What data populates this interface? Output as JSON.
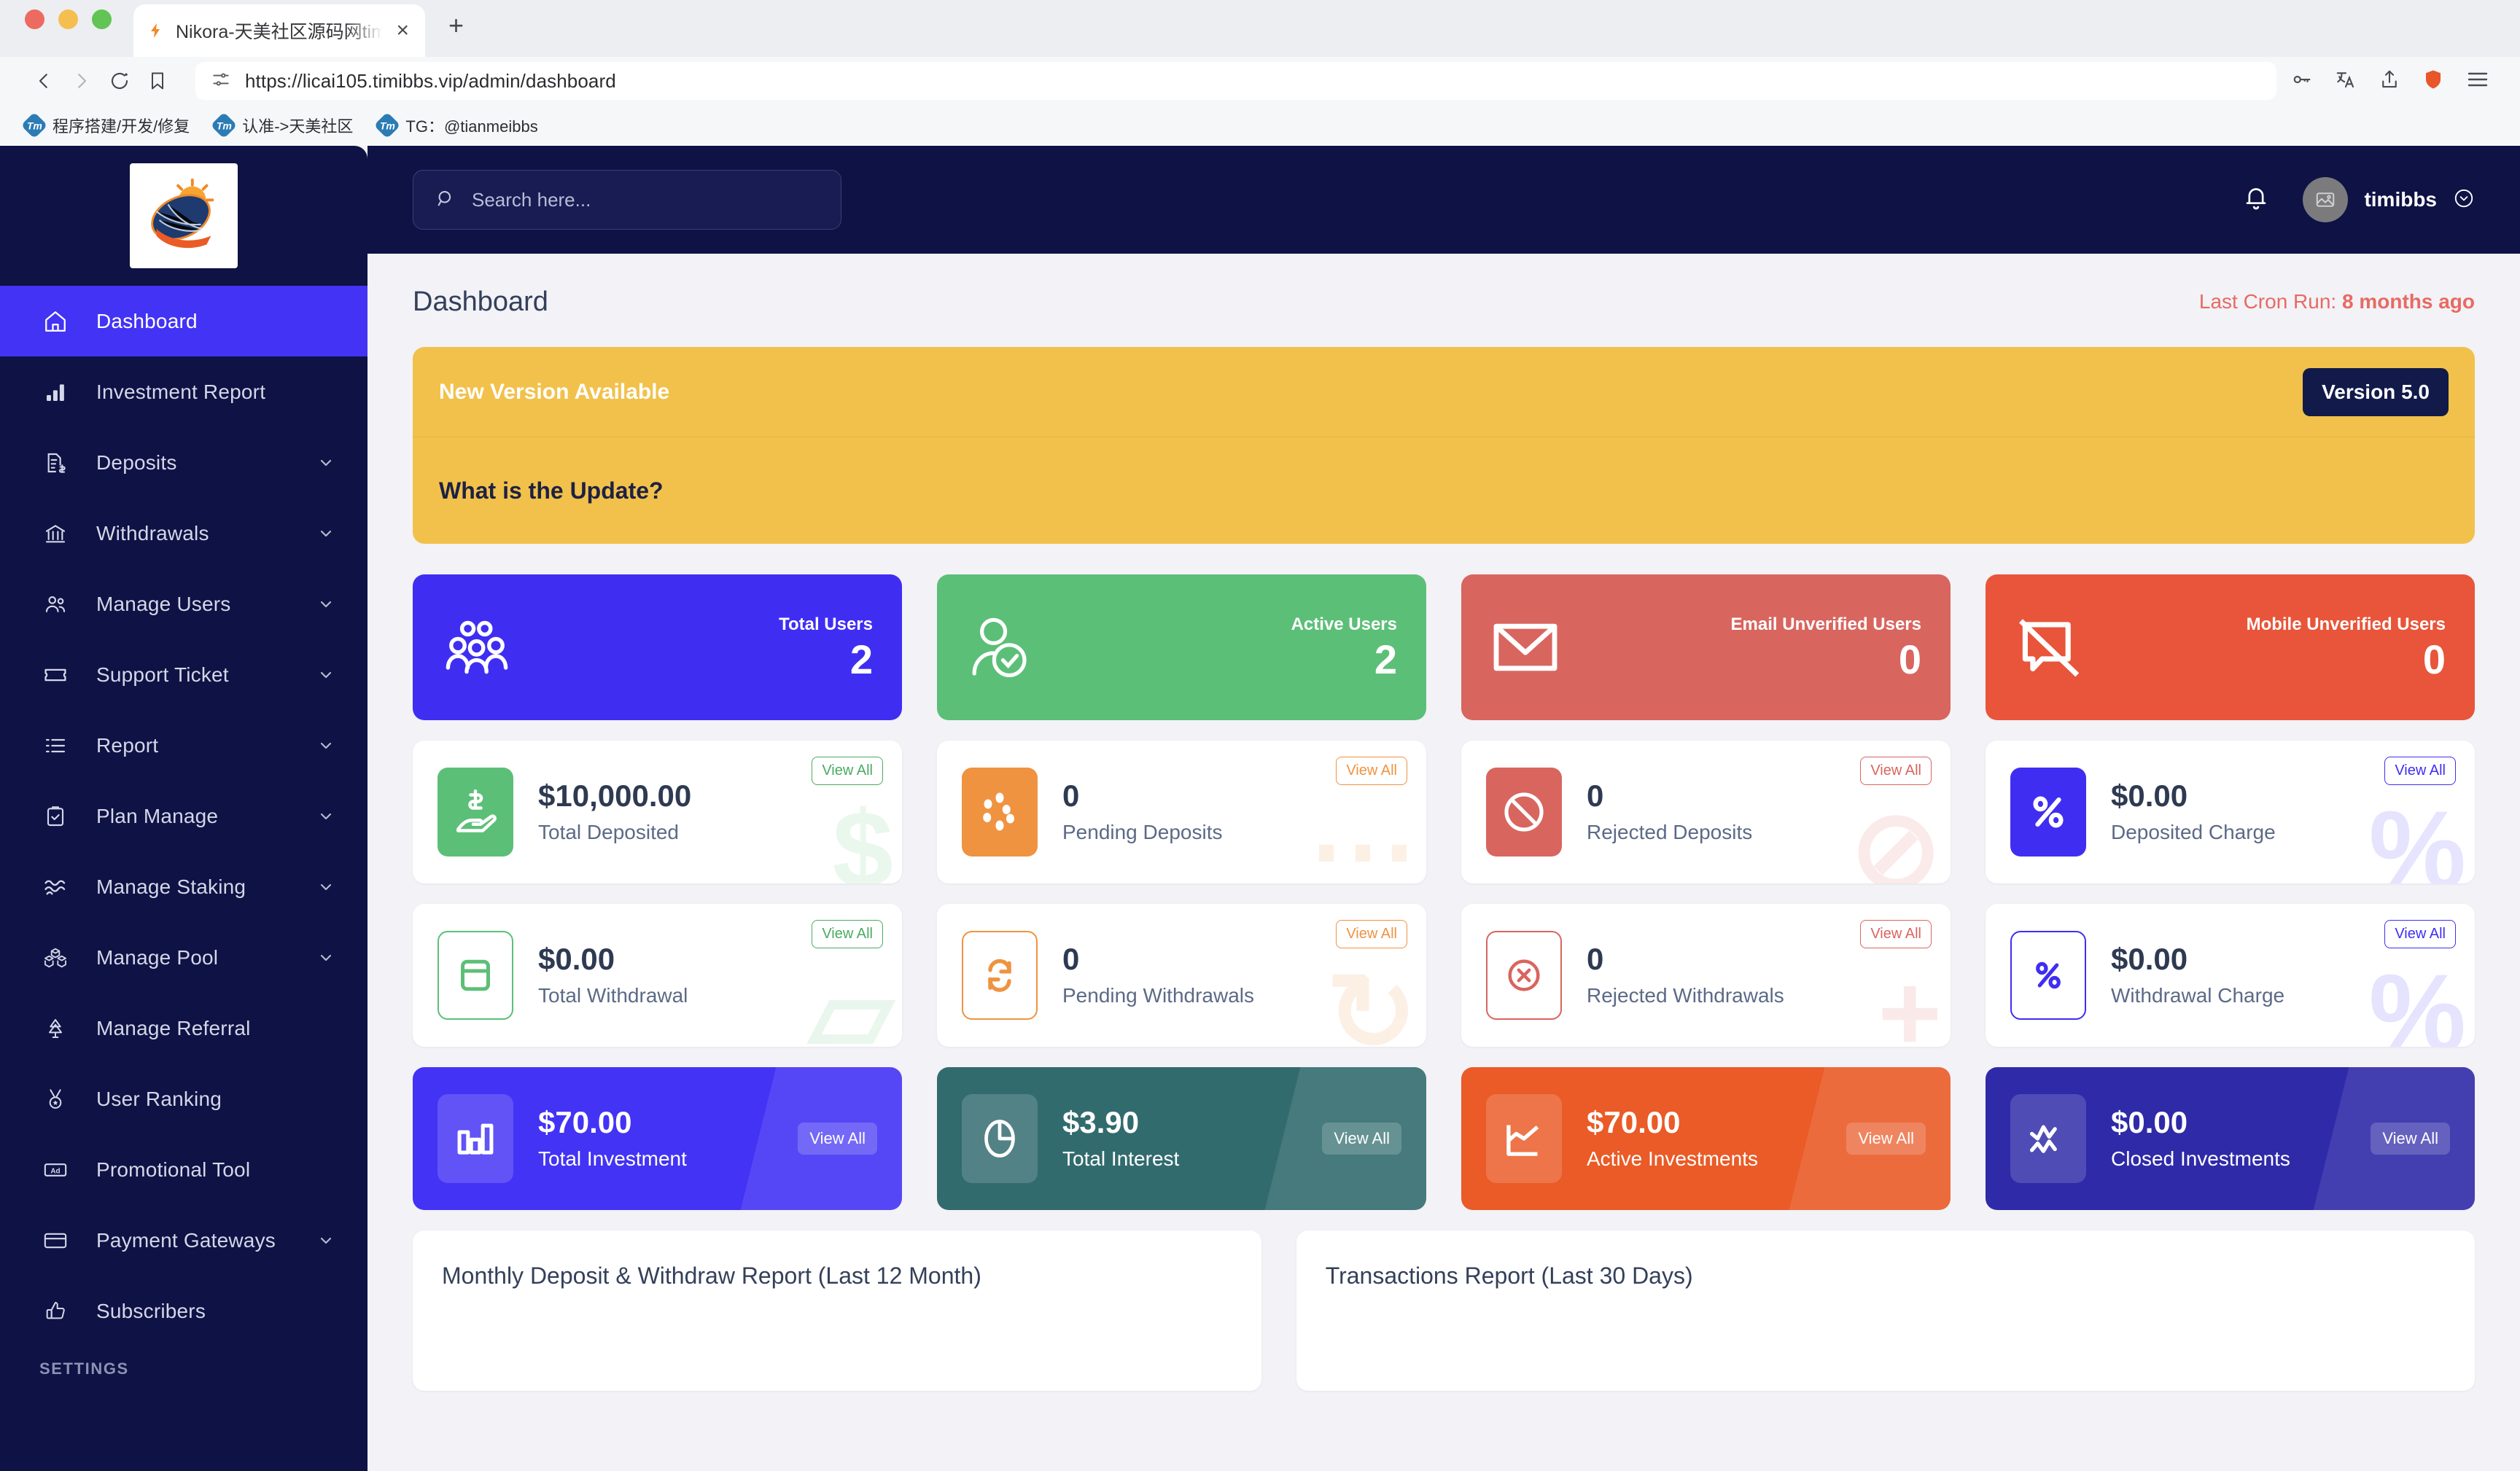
{
  "browser": {
    "tab": {
      "title": "Nikora-天美社区源码网timibbs",
      "favicon": "flash-icon",
      "close": "×"
    },
    "new_tab": "+",
    "url": "https://licai105.timibbs.vip/admin/dashboard",
    "bookmarks": [
      {
        "icon": "Tm",
        "label": "程序搭建/开发/修复"
      },
      {
        "icon": "Tm",
        "label": "认准->天美社区"
      },
      {
        "icon": "Tm",
        "label": "TG：@tianmeibbs"
      }
    ]
  },
  "sidebar": {
    "logo": "globe-sun-logo",
    "items": [
      {
        "label": "Dashboard",
        "icon": "home-icon",
        "active": true,
        "caret": false
      },
      {
        "label": "Investment Report",
        "icon": "bar-chart-icon",
        "active": false,
        "caret": false
      },
      {
        "label": "Deposits",
        "icon": "invoice-dollar-icon",
        "active": false,
        "caret": true
      },
      {
        "label": "Withdrawals",
        "icon": "bank-icon",
        "active": false,
        "caret": true
      },
      {
        "label": "Manage Users",
        "icon": "users-icon",
        "active": false,
        "caret": true
      },
      {
        "label": "Support Ticket",
        "icon": "ticket-icon",
        "active": false,
        "caret": true
      },
      {
        "label": "Report",
        "icon": "list-icon",
        "active": false,
        "caret": true
      },
      {
        "label": "Plan Manage",
        "icon": "clipboard-check-icon",
        "active": false,
        "caret": true
      },
      {
        "label": "Manage Staking",
        "icon": "waves-icon",
        "active": false,
        "caret": true
      },
      {
        "label": "Manage Pool",
        "icon": "boxes-icon",
        "active": false,
        "caret": true
      },
      {
        "label": "Manage Referral",
        "icon": "tree-icon",
        "active": false,
        "caret": false
      },
      {
        "label": "User Ranking",
        "icon": "medal-icon",
        "active": false,
        "caret": false
      },
      {
        "label": "Promotional Tool",
        "icon": "ad-icon",
        "active": false,
        "caret": false
      },
      {
        "label": "Payment Gateways",
        "icon": "credit-card-icon",
        "active": false,
        "caret": true
      },
      {
        "label": "Subscribers",
        "icon": "thumbs-up-icon",
        "active": false,
        "caret": false
      }
    ],
    "section_label": "SETTINGS"
  },
  "topbar": {
    "search_placeholder": "Search here...",
    "search_value": "",
    "notification_icon": "bell-icon",
    "username": "timibbs",
    "avatar_icon": "image-placeholder-icon",
    "caret_icon": "chevron-down-circle-icon"
  },
  "page": {
    "title": "Dashboard",
    "cron_prefix": "Last Cron Run: ",
    "cron_value": "8 months ago"
  },
  "banner": {
    "heading": "New Version Available",
    "badge": "Version 5.0",
    "subheading": "What is the Update?",
    "bg_color": "#f2c14b",
    "badge_color": "#121a4a"
  },
  "user_cards": [
    {
      "label": "Total Users",
      "value": "2",
      "color": "#3f2ef2",
      "icon": "group-users-icon"
    },
    {
      "label": "Active Users",
      "value": "2",
      "color": "#5cbf78",
      "icon": "user-check-icon"
    },
    {
      "label": "Email Unverified Users",
      "value": "0",
      "color": "#d9655f",
      "icon": "envelope-icon"
    },
    {
      "label": "Mobile Unverified Users",
      "value": "0",
      "color": "#e8553a",
      "icon": "mobile-off-icon"
    }
  ],
  "deposit_cards": [
    {
      "value": "$10,000.00",
      "label": "Total Deposited",
      "view": "View All",
      "color": "#5cbf78",
      "filled": true,
      "icon": "hand-dollar-icon",
      "watermark": "$"
    },
    {
      "value": "0",
      "label": "Pending Deposits",
      "view": "View All",
      "color": "#ef9341",
      "filled": true,
      "icon": "spinner-dots-icon",
      "watermark": "⋯"
    },
    {
      "value": "0",
      "label": "Rejected Deposits",
      "view": "View All",
      "color": "#d9655f",
      "filled": true,
      "icon": "ban-icon",
      "watermark": "⊘"
    },
    {
      "value": "$0.00",
      "label": "Deposited Charge",
      "view": "View All",
      "color": "#3f2ef2",
      "filled": true,
      "icon": "percent-icon",
      "watermark": "%"
    }
  ],
  "withdraw_cards": [
    {
      "value": "$0.00",
      "label": "Total Withdrawal",
      "view": "View All",
      "color": "#5cbf78",
      "filled": false,
      "icon": "wallet-icon",
      "watermark": "▱"
    },
    {
      "value": "0",
      "label": "Pending Withdrawals",
      "view": "View All",
      "color": "#ef9341",
      "filled": false,
      "icon": "refresh-icon",
      "watermark": "↻"
    },
    {
      "value": "0",
      "label": "Rejected Withdrawals",
      "view": "View All",
      "color": "#d9655f",
      "filled": false,
      "icon": "x-circle-icon",
      "watermark": "+"
    },
    {
      "value": "$0.00",
      "label": "Withdrawal Charge",
      "view": "View All",
      "color": "#3f2ef2",
      "filled": false,
      "icon": "percent-box-icon",
      "watermark": "%"
    }
  ],
  "investment_cards": [
    {
      "value": "$70.00",
      "label": "Total Investment",
      "view": "View All",
      "color": "#4333f5",
      "icon": "bar-chart-icon"
    },
    {
      "value": "$3.90",
      "label": "Total Interest",
      "view": "View All",
      "color": "#326b6e",
      "icon": "pie-chart-icon"
    },
    {
      "value": "$70.00",
      "label": "Active Investments",
      "view": "View All",
      "color": "#ea5b27",
      "icon": "chart-area-icon"
    },
    {
      "value": "$0.00",
      "label": "Closed Investments",
      "view": "View All",
      "color": "#2f2aa8",
      "icon": "activity-icon"
    }
  ],
  "panels": [
    {
      "title": "Monthly Deposit & Withdraw Report (Last 12 Month)"
    },
    {
      "title": "Transactions Report (Last 30 Days)"
    }
  ]
}
